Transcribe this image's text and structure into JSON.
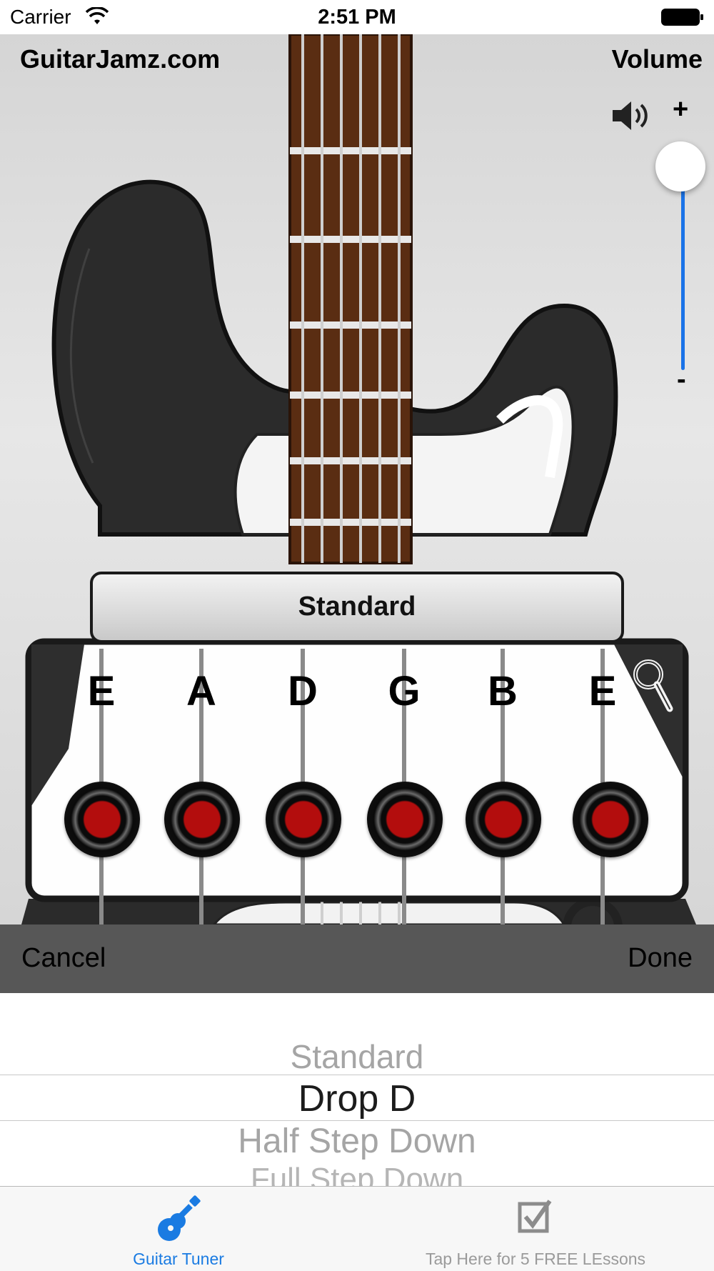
{
  "status_bar": {
    "carrier": "Carrier",
    "time": "2:51 PM"
  },
  "header": {
    "site_title": "GuitarJamz.com",
    "volume_label": "Volume"
  },
  "volume": {
    "plus": "+",
    "minus": "-",
    "level": 1.0,
    "accent": "#1a73e8"
  },
  "tuning": {
    "name": "Standard",
    "strings": [
      "E",
      "A",
      "D",
      "G",
      "B",
      "E"
    ],
    "knob_color": "#b30d0d"
  },
  "action_bar": {
    "cancel": "Cancel",
    "done": "Done"
  },
  "picker": {
    "options": [
      "Standard",
      "Drop D",
      "Half Step Down",
      "Full Step Down"
    ],
    "selected": "Drop D"
  },
  "tab_bar": {
    "tabs": [
      {
        "label": "Guitar Tuner",
        "icon": "guitar-icon",
        "active": true
      },
      {
        "label": "Tap Here for 5 FREE LEssons",
        "icon": "checkbox-icon",
        "active": false
      }
    ],
    "active_color": "#1a7be2"
  }
}
